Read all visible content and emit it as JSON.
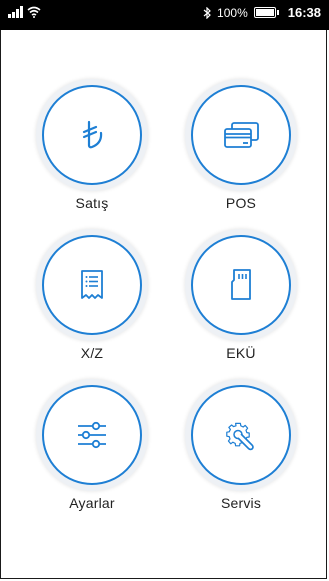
{
  "status_bar": {
    "battery_percent": "100%",
    "time": "16:38",
    "icons": [
      "signal-icon",
      "wifi-icon",
      "bluetooth-icon",
      "battery-icon"
    ]
  },
  "menu": {
    "accent_color": "#1e7fd4",
    "items": [
      {
        "label": "Satış",
        "icon": "lira-icon"
      },
      {
        "label": "POS",
        "icon": "credit-card-icon"
      },
      {
        "label": "X/Z",
        "icon": "receipt-icon"
      },
      {
        "label": "EKÜ",
        "icon": "sd-card-icon"
      },
      {
        "label": "Ayarlar",
        "icon": "sliders-icon"
      },
      {
        "label": "Servis",
        "icon": "wrench-gear-icon"
      }
    ]
  }
}
